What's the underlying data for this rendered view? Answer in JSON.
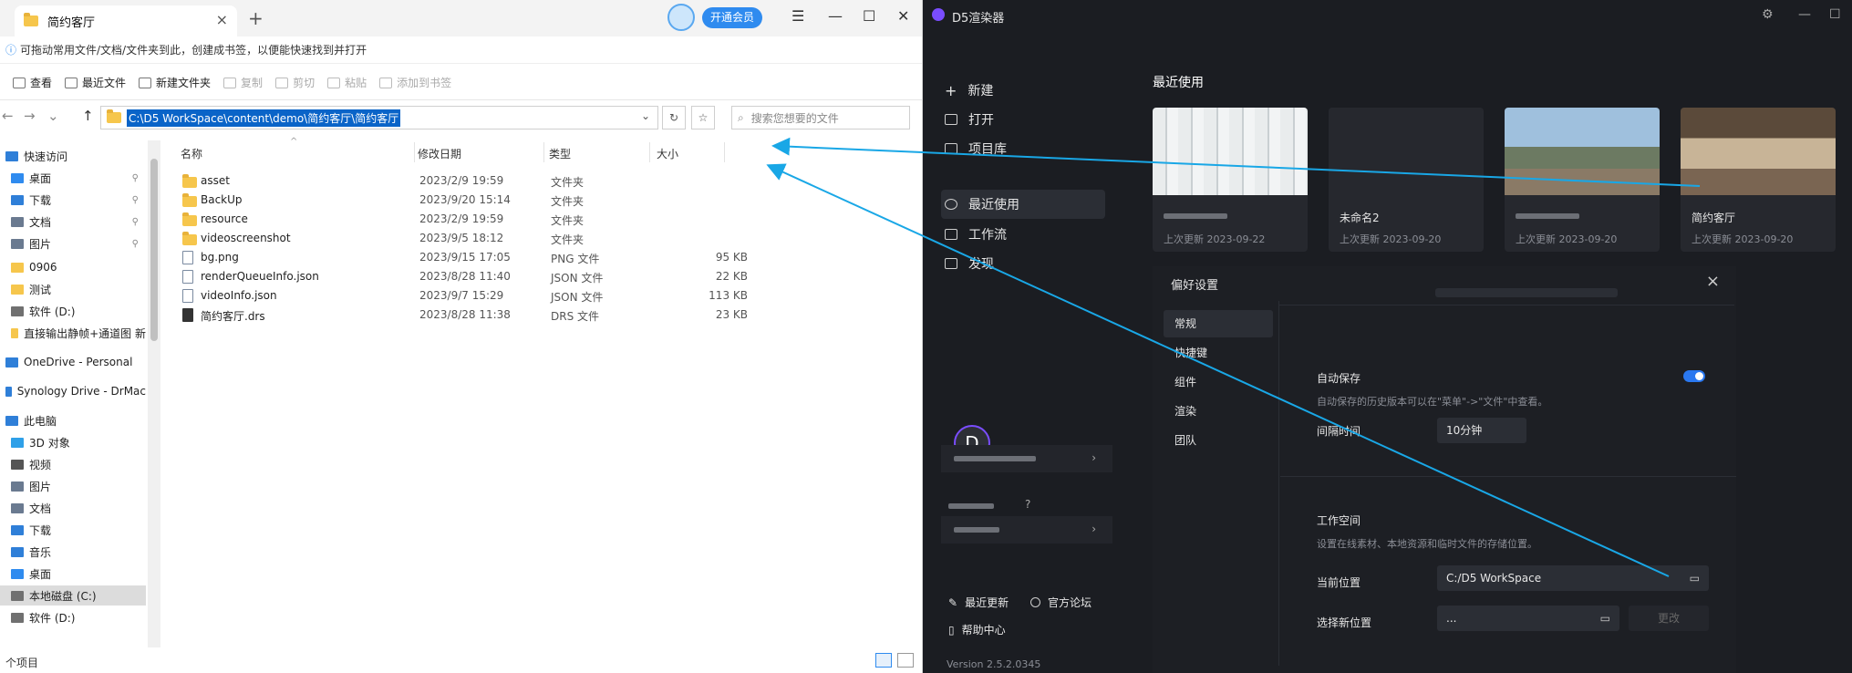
{
  "explorer": {
    "tab_title": "简约客厅",
    "vip_label": "开通会员",
    "infobar": "可拖动常用文件/文档/文件夹到此，创建成书签，以便能快速找到并打开",
    "toolbar": [
      {
        "label": "查看",
        "disabled": false
      },
      {
        "label": "最近文件",
        "disabled": false
      },
      {
        "label": "新建文件夹",
        "disabled": false
      },
      {
        "label": "复制",
        "disabled": true
      },
      {
        "label": "剪切",
        "disabled": true
      },
      {
        "label": "粘贴",
        "disabled": true
      },
      {
        "label": "添加到书签",
        "disabled": true
      }
    ],
    "address": "C:\\D5 WorkSpace\\content\\demo\\简约客厅\\简约客厅",
    "search_placeholder": "搜索您想要的文件",
    "nav": [
      {
        "label": "快速访问",
        "icon": "star-icon",
        "color": "#2f7fd8",
        "pin": false
      },
      {
        "label": "桌面",
        "icon": "desktop-icon",
        "color": "#2f8bef",
        "pin": true
      },
      {
        "label": "下载",
        "icon": "download-icon",
        "color": "#2f7fd8",
        "pin": true
      },
      {
        "label": "文档",
        "icon": "document-icon",
        "color": "#6a7a90",
        "pin": true
      },
      {
        "label": "图片",
        "icon": "picture-icon",
        "color": "#6a7a90",
        "pin": true
      },
      {
        "label": "0906",
        "icon": "folder-icon",
        "color": "#f6c64c",
        "pin": false
      },
      {
        "label": "测试",
        "icon": "folder-icon",
        "color": "#f6c64c",
        "pin": false
      },
      {
        "label": "软件 (D:)",
        "icon": "drive-icon",
        "color": "#707070",
        "pin": false
      },
      {
        "label": "直接输出静帧+通道图 新",
        "icon": "folder-icon",
        "color": "#f6c64c",
        "pin": false
      },
      {
        "label": "OneDrive - Personal",
        "icon": "cloud-icon",
        "color": "#2f7fd8",
        "pin": false
      },
      {
        "label": "Synology Drive - DrMac",
        "icon": "synology-icon",
        "color": "#2f7fd8",
        "pin": false
      },
      {
        "label": "此电脑",
        "icon": "computer-icon",
        "color": "#2f7fd8",
        "pin": false
      },
      {
        "label": "3D 对象",
        "icon": "cube-icon",
        "color": "#2fa0e8",
        "pin": false
      },
      {
        "label": "视频",
        "icon": "video-icon",
        "color": "#555555",
        "pin": false
      },
      {
        "label": "图片",
        "icon": "picture-icon",
        "color": "#6a7a90",
        "pin": false
      },
      {
        "label": "文档",
        "icon": "document-icon",
        "color": "#6a7a90",
        "pin": false
      },
      {
        "label": "下载",
        "icon": "download-icon",
        "color": "#2f7fd8",
        "pin": false
      },
      {
        "label": "音乐",
        "icon": "music-icon",
        "color": "#2f7fd8",
        "pin": false
      },
      {
        "label": "桌面",
        "icon": "desktop-icon",
        "color": "#2f8bef",
        "pin": false
      },
      {
        "label": "本地磁盘 (C:)",
        "icon": "drive-icon",
        "color": "#707070",
        "pin": false
      },
      {
        "label": "软件 (D:)",
        "icon": "drive-icon",
        "color": "#707070",
        "pin": false
      }
    ],
    "columns": {
      "name": "名称",
      "date": "修改日期",
      "type": "类型",
      "size": "大小"
    },
    "files": [
      {
        "name": "asset",
        "date": "2023/2/9 19:59",
        "type": "文件夹",
        "size": "",
        "kind": "folder"
      },
      {
        "name": "BackUp",
        "date": "2023/9/20 15:14",
        "type": "文件夹",
        "size": "",
        "kind": "folder"
      },
      {
        "name": "resource",
        "date": "2023/2/9 19:59",
        "type": "文件夹",
        "size": "",
        "kind": "folder"
      },
      {
        "name": "videoscreenshot",
        "date": "2023/9/5 18:12",
        "type": "文件夹",
        "size": "",
        "kind": "folder"
      },
      {
        "name": "bg.png",
        "date": "2023/9/15 17:05",
        "type": "PNG 文件",
        "size": "95 KB",
        "kind": "file"
      },
      {
        "name": "renderQueueInfo.json",
        "date": "2023/8/28 11:40",
        "type": "JSON 文件",
        "size": "22 KB",
        "kind": "file"
      },
      {
        "name": "videoInfo.json",
        "date": "2023/9/7 15:29",
        "type": "JSON 文件",
        "size": "113 KB",
        "kind": "file"
      },
      {
        "name": "简约客厅.drs",
        "date": "2023/8/28 11:38",
        "type": "DRS 文件",
        "size": "23 KB",
        "kind": "drs"
      }
    ],
    "status": "个项目"
  },
  "d5": {
    "app_title": "D5渲染器",
    "side": {
      "new": "新建",
      "open": "打开",
      "library": "项目库",
      "recent": "最近使用",
      "workflow": "工作流",
      "discover": "发现"
    },
    "recent_title": "最近使用",
    "cards": [
      {
        "name": "",
        "date": "上次更新 2023-09-22",
        "thumb": "blinds"
      },
      {
        "name": "未命名2",
        "date": "上次更新 2023-09-20",
        "thumb": "empty"
      },
      {
        "name": "",
        "date": "上次更新 2023-09-20",
        "thumb": "exterior"
      },
      {
        "name": "简约客厅",
        "date": "上次更新 2023-09-20",
        "thumb": "interior"
      }
    ],
    "prefs": {
      "title": "偏好设置",
      "tabs": [
        "常规",
        "快捷键",
        "组件",
        "渲染",
        "团队"
      ],
      "autosave_label": "自动保存",
      "autosave_desc": "自动保存的历史版本可以在\"菜单\"->\"文件\"中查看。",
      "interval_label": "间隔时间",
      "interval_value": "10分钟",
      "workspace_label": "工作空间",
      "workspace_desc": "设置在线素材、本地资源和临时文件的存储位置。",
      "current_label": "当前位置",
      "current_value": "C:/D5 WorkSpace",
      "new_label": "选择新位置",
      "new_value": "...",
      "change_button": "更改"
    },
    "user_initial": "D",
    "footer": {
      "updates": "最近更新",
      "forum": "官方论坛",
      "help": "帮助中心"
    },
    "version": "Version 2.5.2.0345"
  },
  "colors": {
    "accent": "#2f8bef",
    "d5_accent": "#7a4dff",
    "arrow": "#19a7e6"
  }
}
